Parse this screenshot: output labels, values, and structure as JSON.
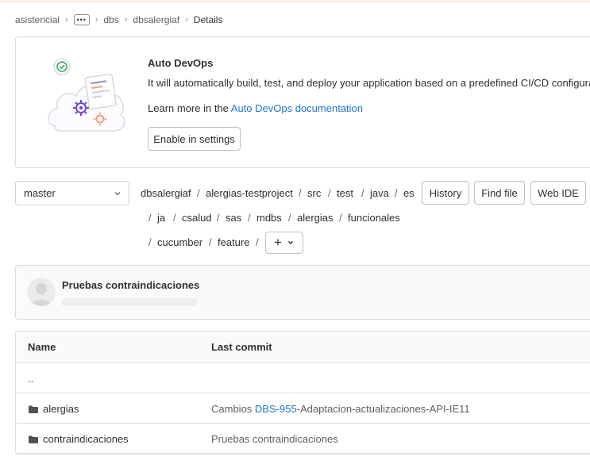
{
  "breadcrumb": {
    "items": [
      "asistencial",
      "dbs",
      "dbsalergiaf"
    ],
    "current": "Details"
  },
  "devops": {
    "title": "Auto DevOps",
    "description": "It will automatically build, test, and deploy your application based on a predefined CI/CD configuration.",
    "learn_prefix": "Learn more in the ",
    "learn_link": "Auto DevOps documentation",
    "button": "Enable in settings"
  },
  "repo": {
    "branch": "master",
    "path": [
      "dbsalergiaf",
      "alergias-testproject",
      "src",
      "test",
      "java",
      "es",
      "ja",
      "csalud",
      "sas",
      "mdbs",
      "alergias",
      "funcionales",
      "cucumber",
      "feature"
    ],
    "buttons": {
      "history": "History",
      "find_file": "Find file",
      "web_ide": "Web IDE"
    },
    "add_symbol": "+"
  },
  "commit": {
    "title": "Pruebas contraindicaciones"
  },
  "tree": {
    "headers": {
      "name": "Name",
      "last_commit": "Last commit"
    },
    "parent": "..",
    "rows": [
      {
        "name": "alergias",
        "commit_prefix": "Cambios ",
        "commit_link": "DBS-955",
        "commit_suffix": "-Adaptacion-actualizaciones-API-IE11"
      },
      {
        "name": "contraindicaciones",
        "commit_prefix": "Pruebas contraindicaciones",
        "commit_link": "",
        "commit_suffix": ""
      }
    ]
  }
}
